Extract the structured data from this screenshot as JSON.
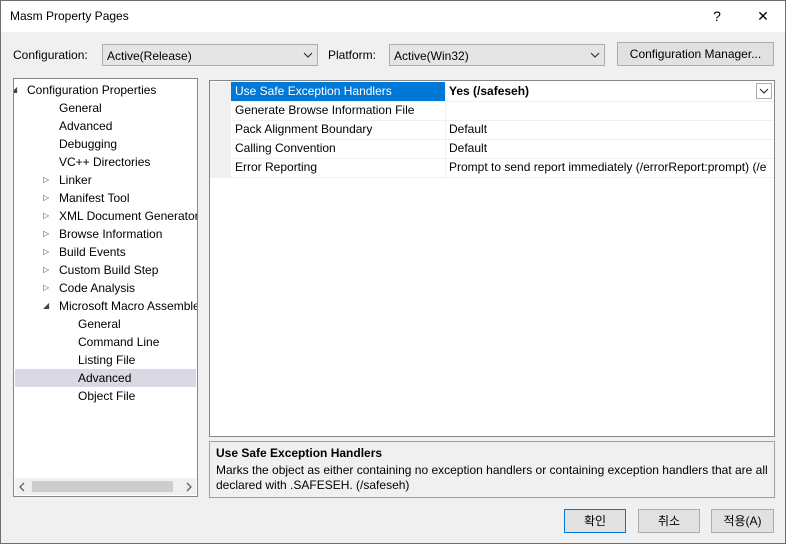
{
  "window": {
    "title": "Masm Property Pages",
    "help_glyph": "?",
    "close_glyph": "✕"
  },
  "config": {
    "configuration_label": "Configuration:",
    "configuration_value": "Active(Release)",
    "platform_label": "Platform:",
    "platform_value": "Active(Win32)",
    "manager_button": "Configuration Manager..."
  },
  "tree": {
    "items": [
      {
        "label": "Configuration Properties",
        "level": 0,
        "expander": "expanded"
      },
      {
        "label": "General",
        "level": 1,
        "expander": "none"
      },
      {
        "label": "Advanced",
        "level": 1,
        "expander": "none"
      },
      {
        "label": "Debugging",
        "level": 1,
        "expander": "none"
      },
      {
        "label": "VC++ Directories",
        "level": 1,
        "expander": "none"
      },
      {
        "label": "Linker",
        "level": 1,
        "expander": "collapsed"
      },
      {
        "label": "Manifest Tool",
        "level": 1,
        "expander": "collapsed"
      },
      {
        "label": "XML Document Generator",
        "level": 1,
        "expander": "collapsed"
      },
      {
        "label": "Browse Information",
        "level": 1,
        "expander": "collapsed"
      },
      {
        "label": "Build Events",
        "level": 1,
        "expander": "collapsed"
      },
      {
        "label": "Custom Build Step",
        "level": 1,
        "expander": "collapsed"
      },
      {
        "label": "Code Analysis",
        "level": 1,
        "expander": "collapsed"
      },
      {
        "label": "Microsoft Macro Assembler",
        "level": 1,
        "expander": "expanded"
      },
      {
        "label": "General",
        "level": 2,
        "expander": "none"
      },
      {
        "label": "Command Line",
        "level": 2,
        "expander": "none"
      },
      {
        "label": "Listing File",
        "level": 2,
        "expander": "none"
      },
      {
        "label": "Advanced",
        "level": 2,
        "expander": "none",
        "selected": true
      },
      {
        "label": "Object File",
        "level": 2,
        "expander": "none"
      }
    ]
  },
  "properties": [
    {
      "name": "Use Safe Exception Handlers",
      "value": "Yes (/safeseh)",
      "selected": true
    },
    {
      "name": "Generate Browse Information File",
      "value": ""
    },
    {
      "name": "Pack Alignment Boundary",
      "value": "Default"
    },
    {
      "name": "Calling Convention",
      "value": "Default"
    },
    {
      "name": "Error Reporting",
      "value": "Prompt to send report immediately (/errorReport:prompt) (/e"
    }
  ],
  "description": {
    "title": "Use Safe Exception Handlers",
    "body": "Marks the object as either containing no exception handlers or containing exception handlers that are all declared with .SAFESEH.     (/safeseh)"
  },
  "buttons": {
    "ok": "확인",
    "cancel": "취소",
    "apply": "적용(A)"
  },
  "colors": {
    "selection_blue": "#0078d7",
    "tree_selection": "#d9d9e6"
  }
}
